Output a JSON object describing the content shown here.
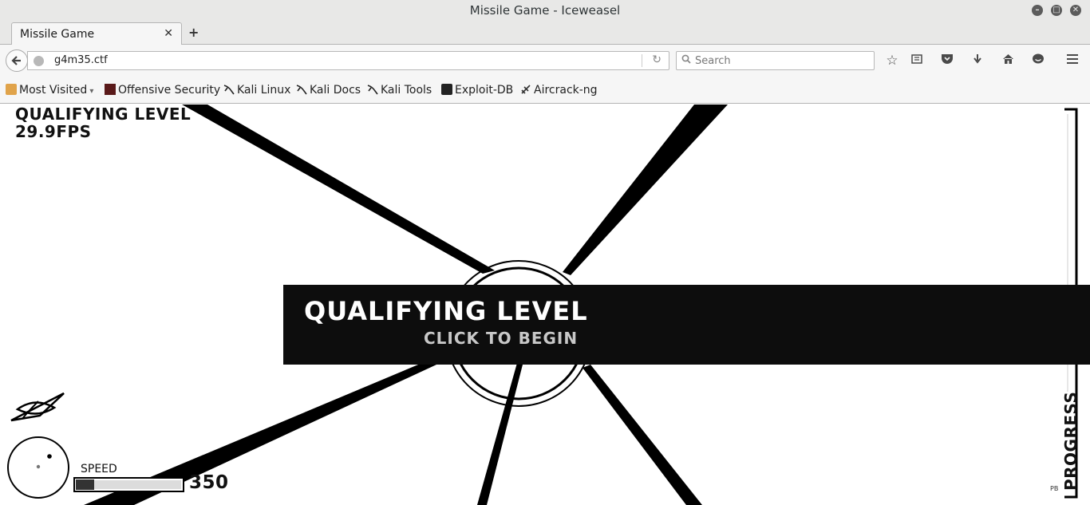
{
  "window": {
    "title": "Missile Game - Iceweasel"
  },
  "tabs": [
    {
      "label": "Missile Game"
    }
  ],
  "navbar": {
    "url": "g4m35.ctf",
    "search_placeholder": "Search"
  },
  "bookmarks": [
    {
      "label": "Most Visited",
      "icon": "most-visited-icon"
    },
    {
      "label": "Offensive Security",
      "icon": "offsec-icon"
    },
    {
      "label": "Kali Linux",
      "icon": "kali-icon"
    },
    {
      "label": "Kali Docs",
      "icon": "kali-icon"
    },
    {
      "label": "Kali Tools",
      "icon": "kali-icon"
    },
    {
      "label": "Exploit-DB",
      "icon": "exploitdb-icon"
    },
    {
      "label": "Aircrack-ng",
      "icon": "aircrack-icon"
    }
  ],
  "game": {
    "hud_level": "QUALIFYING LEVEL",
    "hud_fps": "29.9FPS",
    "banner_title": "QUALIFYING LEVEL",
    "banner_subtitle": "CLICK TO BEGIN",
    "speed_label": "SPEED",
    "speed_value": "350",
    "speed_fraction": 0.17,
    "progress_label": "PROGRESS",
    "corner_text": "PB"
  }
}
